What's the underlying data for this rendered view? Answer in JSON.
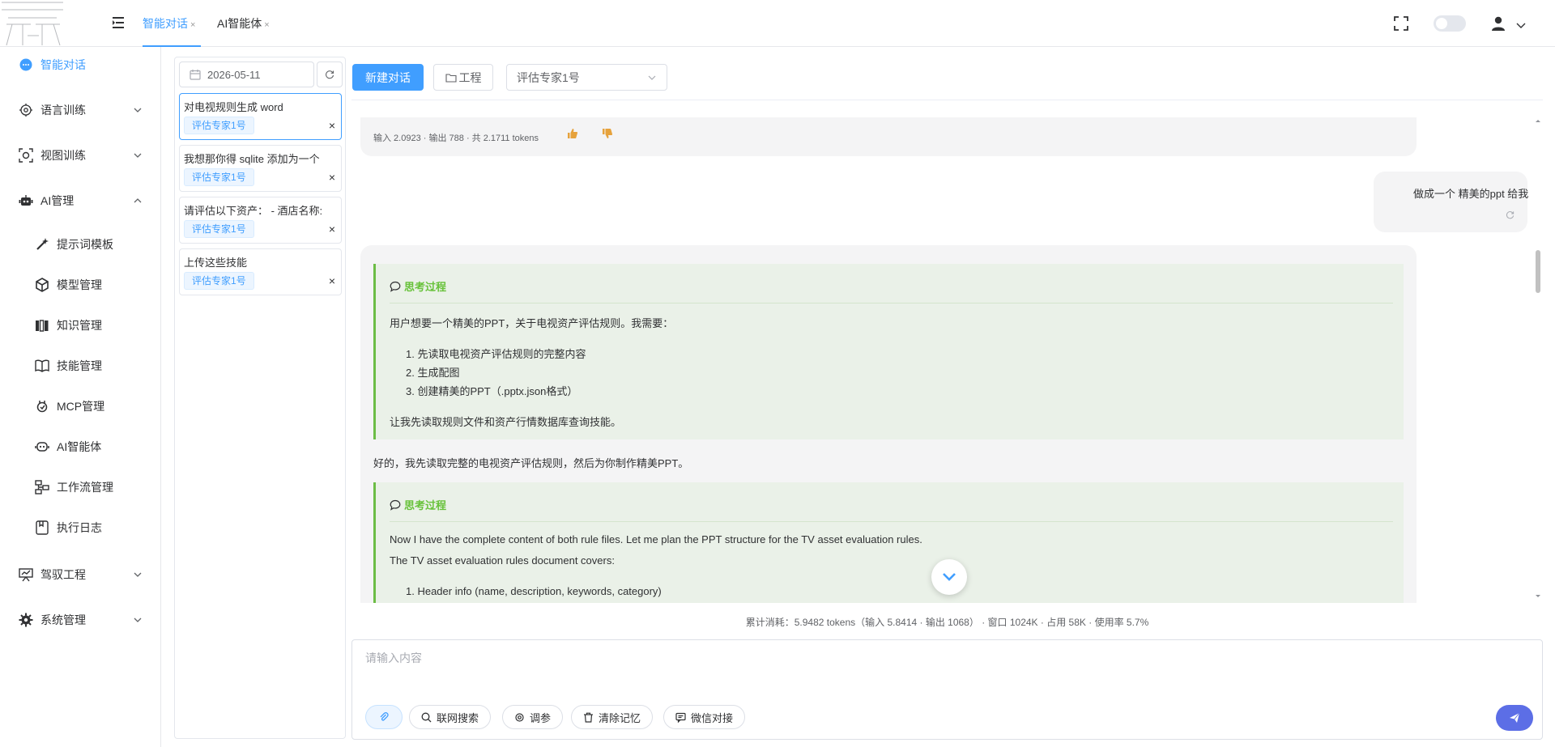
{
  "header": {
    "tabs": [
      {
        "label": "智能对话",
        "close": "×"
      },
      {
        "label": "AI智能体",
        "close": "×"
      }
    ]
  },
  "sidebar": {
    "items": [
      {
        "label": "智能对话"
      },
      {
        "label": "语言训练"
      },
      {
        "label": "视图训练"
      },
      {
        "label": "AI管理"
      },
      {
        "label": "提示词模板"
      },
      {
        "label": "模型管理"
      },
      {
        "label": "知识管理"
      },
      {
        "label": "技能管理"
      },
      {
        "label": "MCP管理"
      },
      {
        "label": "AI智能体"
      },
      {
        "label": "工作流管理"
      },
      {
        "label": "执行日志"
      },
      {
        "label": "驾驭工程"
      },
      {
        "label": "系统管理"
      }
    ]
  },
  "conversations": {
    "date": "2026-05-11",
    "items": [
      {
        "title": "对电视规则生成 word",
        "tag": "评估专家1号",
        "close": "×"
      },
      {
        "title": "我想那你得 sqlite 添加为一个",
        "tag": "评估专家1号",
        "close": "×"
      },
      {
        "title": "请评估以下资产：  - 酒店名称:",
        "tag": "评估专家1号",
        "close": "×"
      },
      {
        "title": "上传这些技能",
        "tag": "评估专家1号",
        "close": "×"
      }
    ]
  },
  "toolbar": {
    "new_chat": "新建对话",
    "project": "工程",
    "agent_select": "评估专家1号"
  },
  "chat": {
    "prev_meta": "输入 2.0923 · 输出 788 · 共 2.1711 tokens",
    "user_msg": "做成一个 精美的ppt 给我",
    "think1": {
      "header": "思考过程",
      "intro": "用户想要一个精美的PPT，关于电视资产评估规则。我需要：",
      "steps": [
        "1. 先读取电视资产评估规则的完整内容",
        "2. 生成配图",
        "3. 创建精美的PPT（.pptx.json格式）"
      ],
      "outro": "让我先读取规则文件和资产行情数据库查询技能。"
    },
    "reply": "好的，我先读取完整的电视资产评估规则，然后为你制作精美PPT。",
    "think2": {
      "header": "思考过程",
      "line1": "Now I have the complete content of both rule files. Let me plan the PPT structure for the TV asset evaluation rules.",
      "line2": "The TV asset evaluation rules document covers:",
      "step1": "1. Header info (name, description, keywords, category)"
    }
  },
  "usage": "累计消耗：5.9482 tokens（输入 5.8414 · 输出 1068） · 窗口 1024K · 占用 58K · 使用率 5.7%",
  "input": {
    "placeholder": "请输入内容",
    "buttons": [
      "联网搜索",
      "调参",
      "清除记忆",
      "微信对接"
    ]
  },
  "colors": {
    "accent": "#409eff",
    "think_border": "#6cbd45",
    "send": "#5c6ee6"
  }
}
